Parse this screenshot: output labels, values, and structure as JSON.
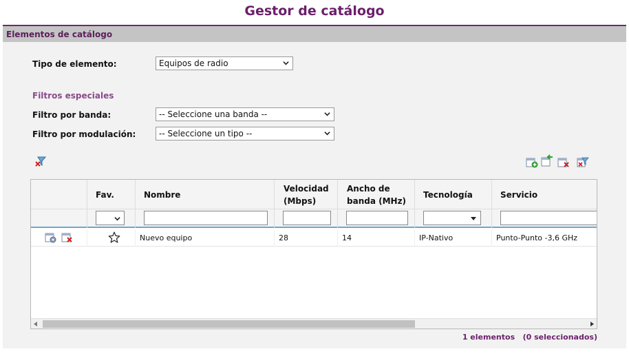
{
  "page": {
    "title": "Gestor de catálogo"
  },
  "panel": {
    "header": "Elementos de catálogo"
  },
  "form": {
    "tipo_label": "Tipo de elemento:",
    "tipo_value": "Equipos de radio",
    "filters_heading": "Filtros especiales",
    "banda_label": "Filtro por banda:",
    "banda_value": "-- Seleccione una banda --",
    "modulacion_label": "Filtro por modulación:",
    "modulacion_value": "-- Seleccione un tipo --"
  },
  "table": {
    "columns": {
      "fav": "Fav.",
      "nombre": "Nombre",
      "velocidad_1": "Velocidad",
      "velocidad_2": "(Mbps)",
      "ancho_1": "Ancho de",
      "ancho_2": "banda (MHz)",
      "tecnologia": "Tecnología",
      "servicio": "Servicio"
    },
    "rows": [
      {
        "nombre": "Nuevo equipo",
        "velocidad": "28",
        "ancho": "14",
        "tecnologia": "IP-Nativo",
        "servicio": "Punto-Punto -3,6 GHz"
      }
    ]
  },
  "footer": {
    "count": "1 elementos   (0 seleccionados)"
  },
  "colors": {
    "accent": "#6b1f6b",
    "header_bg": "#c4c4c4",
    "panel_bg": "#f2f2f2"
  },
  "icons": [
    "clear-filter-icon",
    "add-icon",
    "import-icon",
    "delete-icon",
    "delete-filter-icon",
    "details-icon",
    "remove-icon",
    "star-icon"
  ]
}
